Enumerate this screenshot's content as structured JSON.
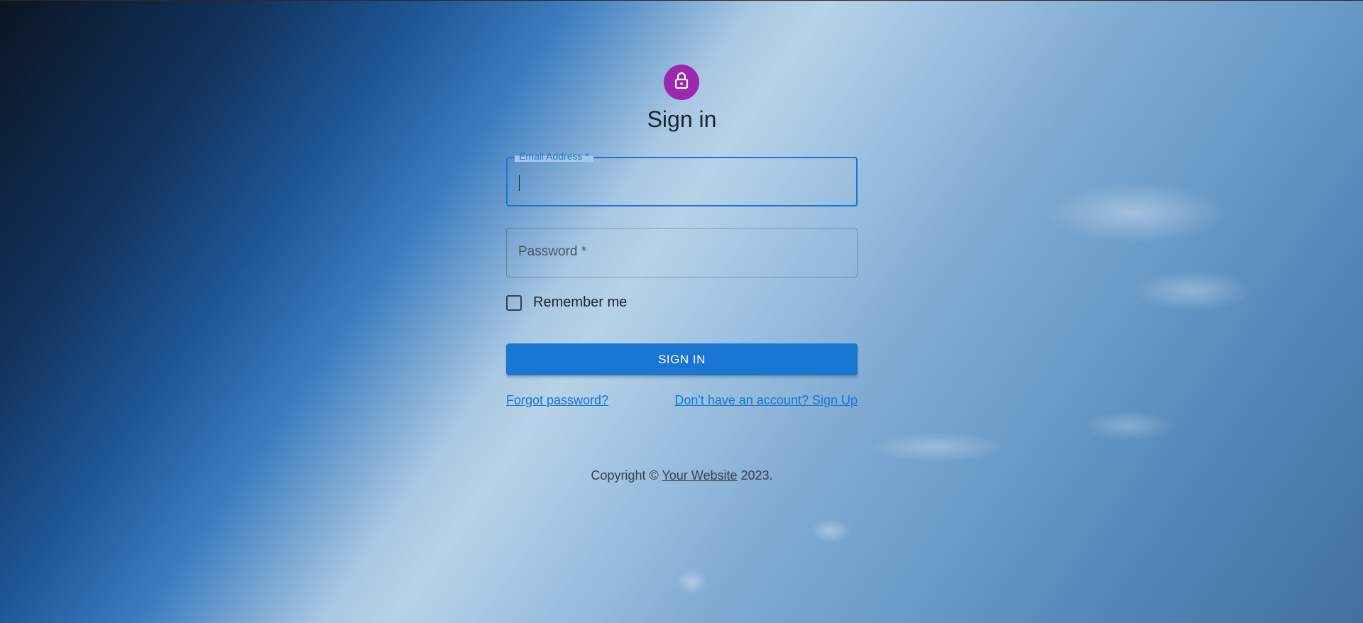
{
  "colors": {
    "primary": "#1976d2",
    "avatar": "#9c27b0"
  },
  "header": {
    "icon": "lock-icon",
    "title": "Sign in"
  },
  "email": {
    "label": "Email Address *",
    "value": ""
  },
  "password": {
    "label": "Password *",
    "value": ""
  },
  "remember": {
    "label": "Remember me",
    "checked": false
  },
  "submit": {
    "label": "SIGN IN"
  },
  "links": {
    "forgot": "Forgot password?",
    "signup": "Don't have an account? Sign Up"
  },
  "footer": {
    "prefix": "Copyright ©",
    "link": "Your Website",
    "suffix": "2023."
  }
}
